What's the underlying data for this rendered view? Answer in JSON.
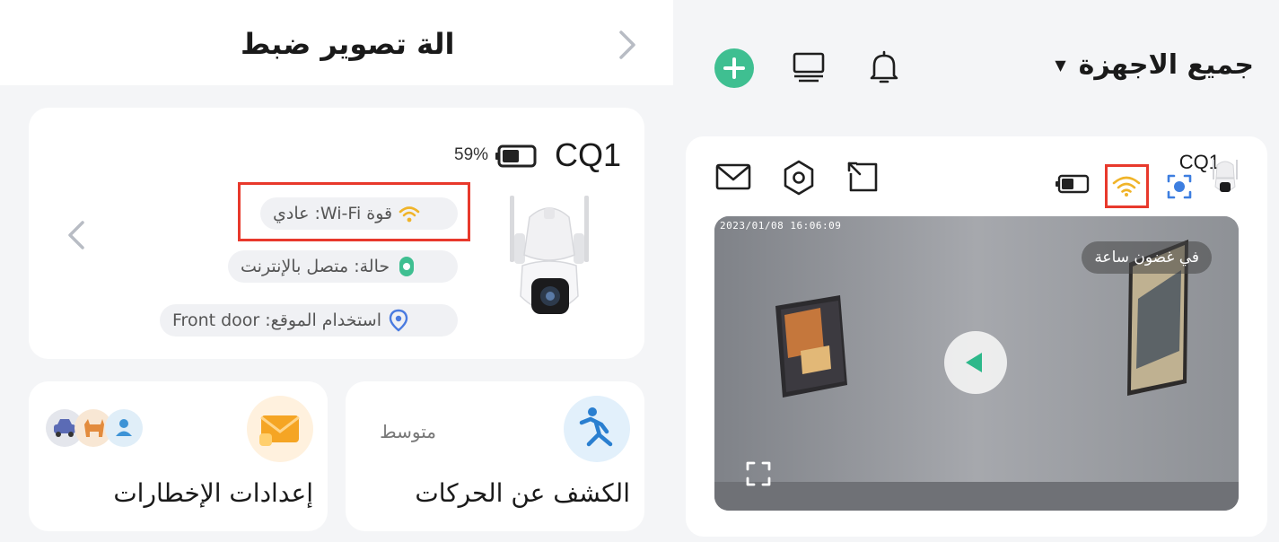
{
  "left_panel": {
    "title": "الة تصوير ضبط",
    "camera": {
      "name": "CQ1",
      "battery_percent": "59%",
      "wifi_strength": "قوة Wi-Fi: عادي",
      "status": "حالة: متصل بالإنترنت",
      "location": "استخدام الموقع: Front door"
    },
    "tiles": [
      {
        "title": "إعدادات الإخطارات",
        "icon": "envelope-icon",
        "mini_icons": [
          "car-icon",
          "pet-icon",
          "person-icon"
        ]
      },
      {
        "title": "الكشف عن الحركات",
        "value": "متوسط",
        "icon": "motion-icon"
      }
    ]
  },
  "right_panel": {
    "title": "جميع الاجهزة",
    "header_icons": [
      "add-icon",
      "device-grid-icon",
      "bell-icon"
    ],
    "device": {
      "name": "CQ1",
      "actions": [
        "mail-icon",
        "settings-icon",
        "share-icon"
      ],
      "status_icons": [
        "battery-icon",
        "wifi-icon",
        "ai-detect-icon"
      ],
      "timestamp": "2023/01/08 16:06:09",
      "badge": "في غضون ساعة"
    }
  },
  "colors": {
    "accent_green": "#3fbf91",
    "highlight_red": "#e8392c",
    "wifi_yellow": "#f0b429",
    "location_blue": "#4a7be0"
  }
}
